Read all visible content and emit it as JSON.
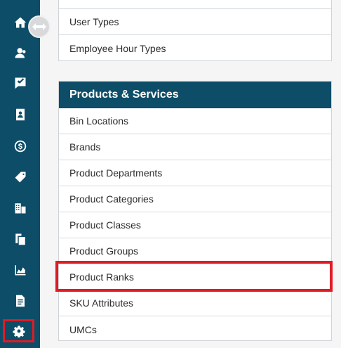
{
  "sidebar": {
    "items": [
      {
        "icon": "home-icon"
      },
      {
        "icon": "user-icon"
      },
      {
        "icon": "tasks-icon"
      },
      {
        "icon": "contacts-icon"
      },
      {
        "icon": "dollar-icon"
      },
      {
        "icon": "tag-icon"
      },
      {
        "icon": "buildings-icon"
      },
      {
        "icon": "copy-icon"
      },
      {
        "icon": "chart-icon"
      },
      {
        "icon": "document-icon"
      },
      {
        "icon": "gear-icon",
        "active": true
      }
    ]
  },
  "employees": {
    "items": [
      "User Types",
      "Employee Hour Types"
    ]
  },
  "products": {
    "title": "Products & Services",
    "items": [
      "Bin Locations",
      "Brands",
      "Product Departments",
      "Product Categories",
      "Product Classes",
      "Product Groups",
      "Product Ranks",
      "SKU Attributes",
      "UMCs"
    ],
    "highlighted": "Product Ranks"
  },
  "colors": {
    "sidebar": "#0d4d68",
    "highlight": "#e01b24",
    "background": "#f5f5f5"
  }
}
